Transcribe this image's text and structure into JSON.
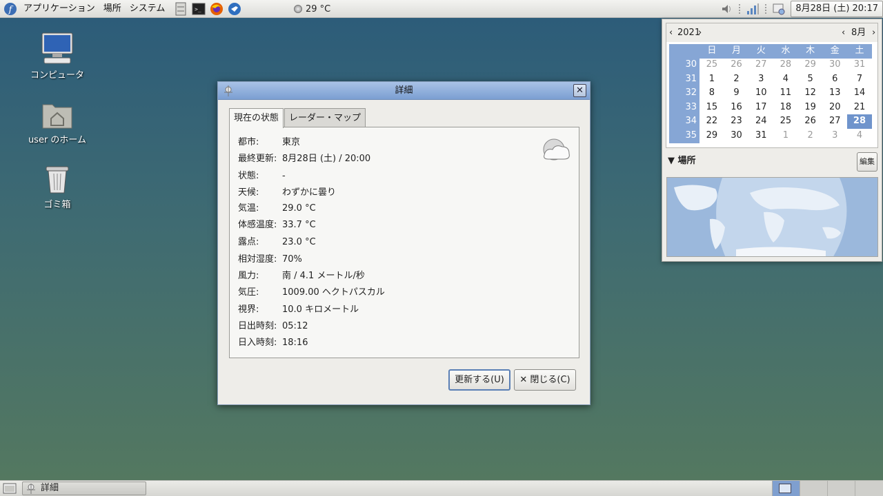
{
  "top_panel": {
    "menus": [
      "アプリケーション",
      "場所",
      "システム"
    ],
    "weather_temp": "29 °C",
    "clock": "8月28日 (土) 20:17"
  },
  "desktop": {
    "icons": [
      {
        "label": "コンピュータ",
        "icon": "computer-icon"
      },
      {
        "label": "user のホーム",
        "icon": "home-folder-icon"
      },
      {
        "label": "ゴミ箱",
        "icon": "trash-icon"
      }
    ]
  },
  "dialog": {
    "title": "詳細",
    "tabs": [
      "現在の状態",
      "レーダー・マップ"
    ],
    "rows": [
      {
        "k": "都市:",
        "v": "東京"
      },
      {
        "k": "最終更新:",
        "v": "8月28日 (土) / 20:00"
      },
      {
        "k": "状態:",
        "v": "-"
      },
      {
        "k": "天候:",
        "v": "わずかに曇り"
      },
      {
        "k": "気温:",
        "v": "29.0 °C"
      },
      {
        "k": "体感温度:",
        "v": "33.7 °C"
      },
      {
        "k": "露点:",
        "v": "23.0 °C"
      },
      {
        "k": "相対湿度:",
        "v": "70%"
      },
      {
        "k": "風力:",
        "v": "南 / 4.1 メートル/秒"
      },
      {
        "k": "気圧:",
        "v": "1009.00 ヘクトパスカル"
      },
      {
        "k": "視界:",
        "v": "10.0 キロメートル"
      },
      {
        "k": "日出時刻:",
        "v": "05:12"
      },
      {
        "k": "日入時刻:",
        "v": "18:16"
      }
    ],
    "update_button": "更新する(U)",
    "close_button": "閉じる(C)"
  },
  "calendar": {
    "year": "2021",
    "month": "8月",
    "weekday_headers": [
      "日",
      "月",
      "火",
      "水",
      "木",
      "金",
      "土"
    ],
    "weeks": [
      {
        "wk": "30",
        "days": [
          "25",
          "26",
          "27",
          "28",
          "29",
          "30",
          "31"
        ],
        "dim": [
          1,
          1,
          1,
          1,
          1,
          1,
          1
        ]
      },
      {
        "wk": "31",
        "days": [
          "1",
          "2",
          "3",
          "4",
          "5",
          "6",
          "7"
        ],
        "dim": [
          0,
          0,
          0,
          0,
          0,
          0,
          0
        ]
      },
      {
        "wk": "32",
        "days": [
          "8",
          "9",
          "10",
          "11",
          "12",
          "13",
          "14"
        ],
        "dim": [
          0,
          0,
          0,
          0,
          0,
          0,
          0
        ]
      },
      {
        "wk": "33",
        "days": [
          "15",
          "16",
          "17",
          "18",
          "19",
          "20",
          "21"
        ],
        "dim": [
          0,
          0,
          0,
          0,
          0,
          0,
          0
        ]
      },
      {
        "wk": "34",
        "days": [
          "22",
          "23",
          "24",
          "25",
          "26",
          "27",
          "28"
        ],
        "dim": [
          0,
          0,
          0,
          0,
          0,
          0,
          0
        ]
      },
      {
        "wk": "35",
        "days": [
          "29",
          "30",
          "31",
          "1",
          "2",
          "3",
          "4"
        ],
        "dim": [
          0,
          0,
          0,
          1,
          1,
          1,
          1
        ]
      }
    ],
    "selected_day": "28",
    "locations_label": "場所",
    "edit_button": "編集"
  },
  "taskbar": {
    "window_item": "詳細"
  },
  "colors": {
    "accent": "#86a6d5",
    "selected": "#6f94cc"
  }
}
